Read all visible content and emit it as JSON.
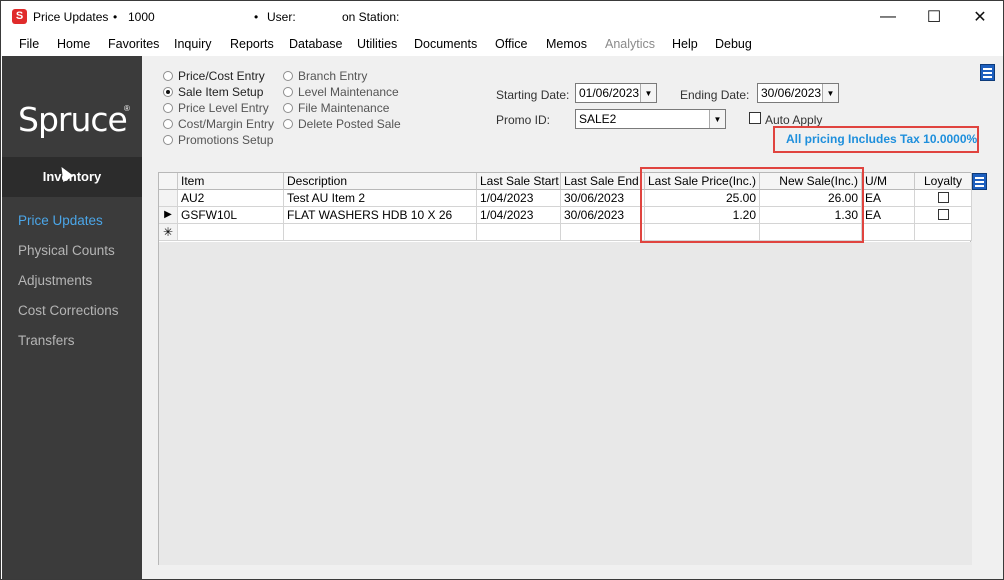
{
  "title_bar": {
    "app_icon_letter": "S",
    "title": "Price Updates",
    "bullet1": "•",
    "number": "1000",
    "bullet2": "•",
    "user_label": "User:",
    "station_label": "on Station:",
    "minimize": "—",
    "maximize": "☐",
    "close": "✕"
  },
  "menu": [
    "File",
    "Home",
    "Favorites",
    "Inquiry",
    "Reports",
    "Database",
    "Utilities",
    "Documents",
    "Office",
    "Memos",
    "Analytics",
    "Help",
    "Debug"
  ],
  "sidebar": {
    "logo": "Spruce",
    "logo_mark": "®",
    "module": "Inventory",
    "items": [
      "Price Updates",
      "Physical Counts",
      "Adjustments",
      "Cost Corrections",
      "Transfers"
    ],
    "active_index": 0,
    "active_color": "#4ba6e8"
  },
  "options": {
    "left": [
      {
        "label": "Price/Cost Entry",
        "selected": false
      },
      {
        "label": "Sale Item Setup",
        "selected": true
      },
      {
        "label": "Price Level Entry",
        "selected": false
      },
      {
        "label": "Cost/Margin Entry",
        "selected": false
      },
      {
        "label": "Promotions Setup",
        "selected": false
      }
    ],
    "right": [
      {
        "label": "Branch Entry",
        "selected": false
      },
      {
        "label": "Level Maintenance",
        "selected": false
      },
      {
        "label": "File Maintenance",
        "selected": false
      },
      {
        "label": "Delete Posted Sale",
        "selected": false
      }
    ]
  },
  "filters": {
    "starting_date_label": "Starting Date:",
    "starting_date": "01/06/2023",
    "ending_date_label": "Ending Date:",
    "ending_date": "30/06/2023",
    "promo_label": "Promo ID:",
    "promo_id": "SALE2",
    "auto_apply_label": "Auto Apply",
    "auto_apply_checked": false,
    "tax_note": "All pricing Includes Tax 10.0000%",
    "tax_note_color": "#1e8fdc",
    "highlight_color": "#e0443f"
  },
  "grid": {
    "columns": [
      "Item",
      "Description",
      "Last Sale Start",
      "Last Sale End",
      "Last Sale Price(Inc.)",
      "New Sale(Inc.)",
      "U/M",
      "Loyalty"
    ],
    "rows": [
      {
        "indicator": "",
        "item": "AU2",
        "description": "Test AU Item 2",
        "last_start": "1/04/2023",
        "last_end": "30/06/2023",
        "last_price": "25.00",
        "new_sale": "26.00",
        "um": "EA",
        "loyalty": false
      },
      {
        "indicator": "▶",
        "item": "GSFW10L",
        "description": "FLAT WASHERS HDB 10 X 26",
        "last_start": "1/04/2023",
        "last_end": "30/06/2023",
        "last_price": "1.20",
        "new_sale": "1.30",
        "um": "EA",
        "loyalty": false
      }
    ],
    "new_row_indicator": "✳"
  },
  "icons": {
    "app": "spruce-app-icon",
    "grid_menu": "list-menu-icon",
    "cursor": "mouse-cursor-icon",
    "dropdown": "dropdown-arrow-icon",
    "row_pointer": "row-pointer-icon"
  }
}
